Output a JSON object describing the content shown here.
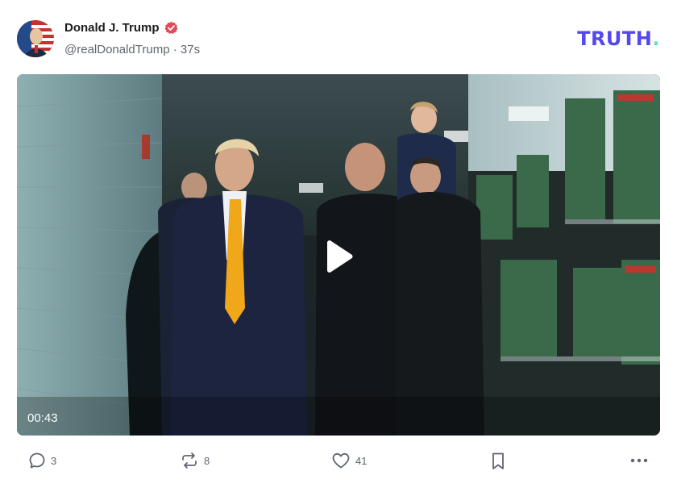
{
  "author": {
    "display_name": "Donald J. Trump",
    "handle": "@realDonaldTrump",
    "separator": " · ",
    "time_ago": "37s",
    "verified_icon": "verified-badge-icon",
    "verified_color": "#e14c5b"
  },
  "brand": {
    "logo_text": "TRUTH",
    "logo_dot": ".",
    "logo_color": "#5448ee",
    "dot_color": "#5ee0c8"
  },
  "media": {
    "type": "video",
    "duration": "00:43",
    "play_icon": "play-icon"
  },
  "actions": {
    "replies": {
      "icon": "reply-icon",
      "count": "3"
    },
    "retruths": {
      "icon": "retruth-icon",
      "count": "8"
    },
    "likes": {
      "icon": "heart-icon",
      "count": "41"
    },
    "bookmark": {
      "icon": "bookmark-icon"
    },
    "more": {
      "icon": "more-icon"
    }
  }
}
